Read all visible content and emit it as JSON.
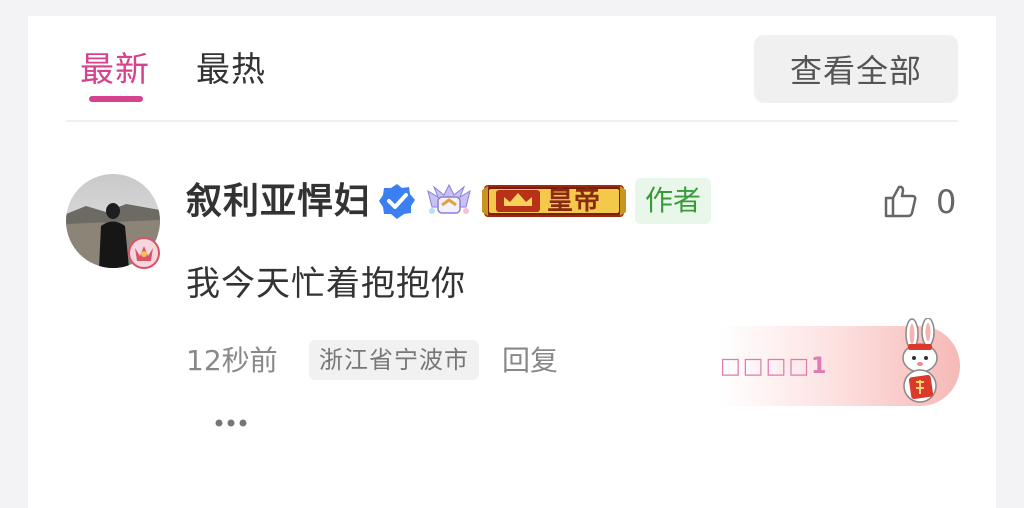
{
  "tabs": [
    {
      "label": "最新",
      "active": true
    },
    {
      "label": "最热",
      "active": false
    }
  ],
  "view_all_label": "查看全部",
  "comment": {
    "username": "叙利亚悍妇",
    "badge_text": "皇帝",
    "author_tag": "作者",
    "like_count": "0",
    "text": "我今天忙着抱抱你",
    "time": "12秒前",
    "location": "浙江省宁波市",
    "reply_label": "回复",
    "decor_text": "□□□□1"
  },
  "colors": {
    "accent": "#d6428e",
    "author_green": "#3a9a3a",
    "verified_blue": "#3b7ff0"
  },
  "icons": [
    "verified-icon",
    "level-badge-icon",
    "emperor-badge-icon",
    "like-thumb-icon",
    "more-dots-icon",
    "rabbit-decoration-icon"
  ]
}
